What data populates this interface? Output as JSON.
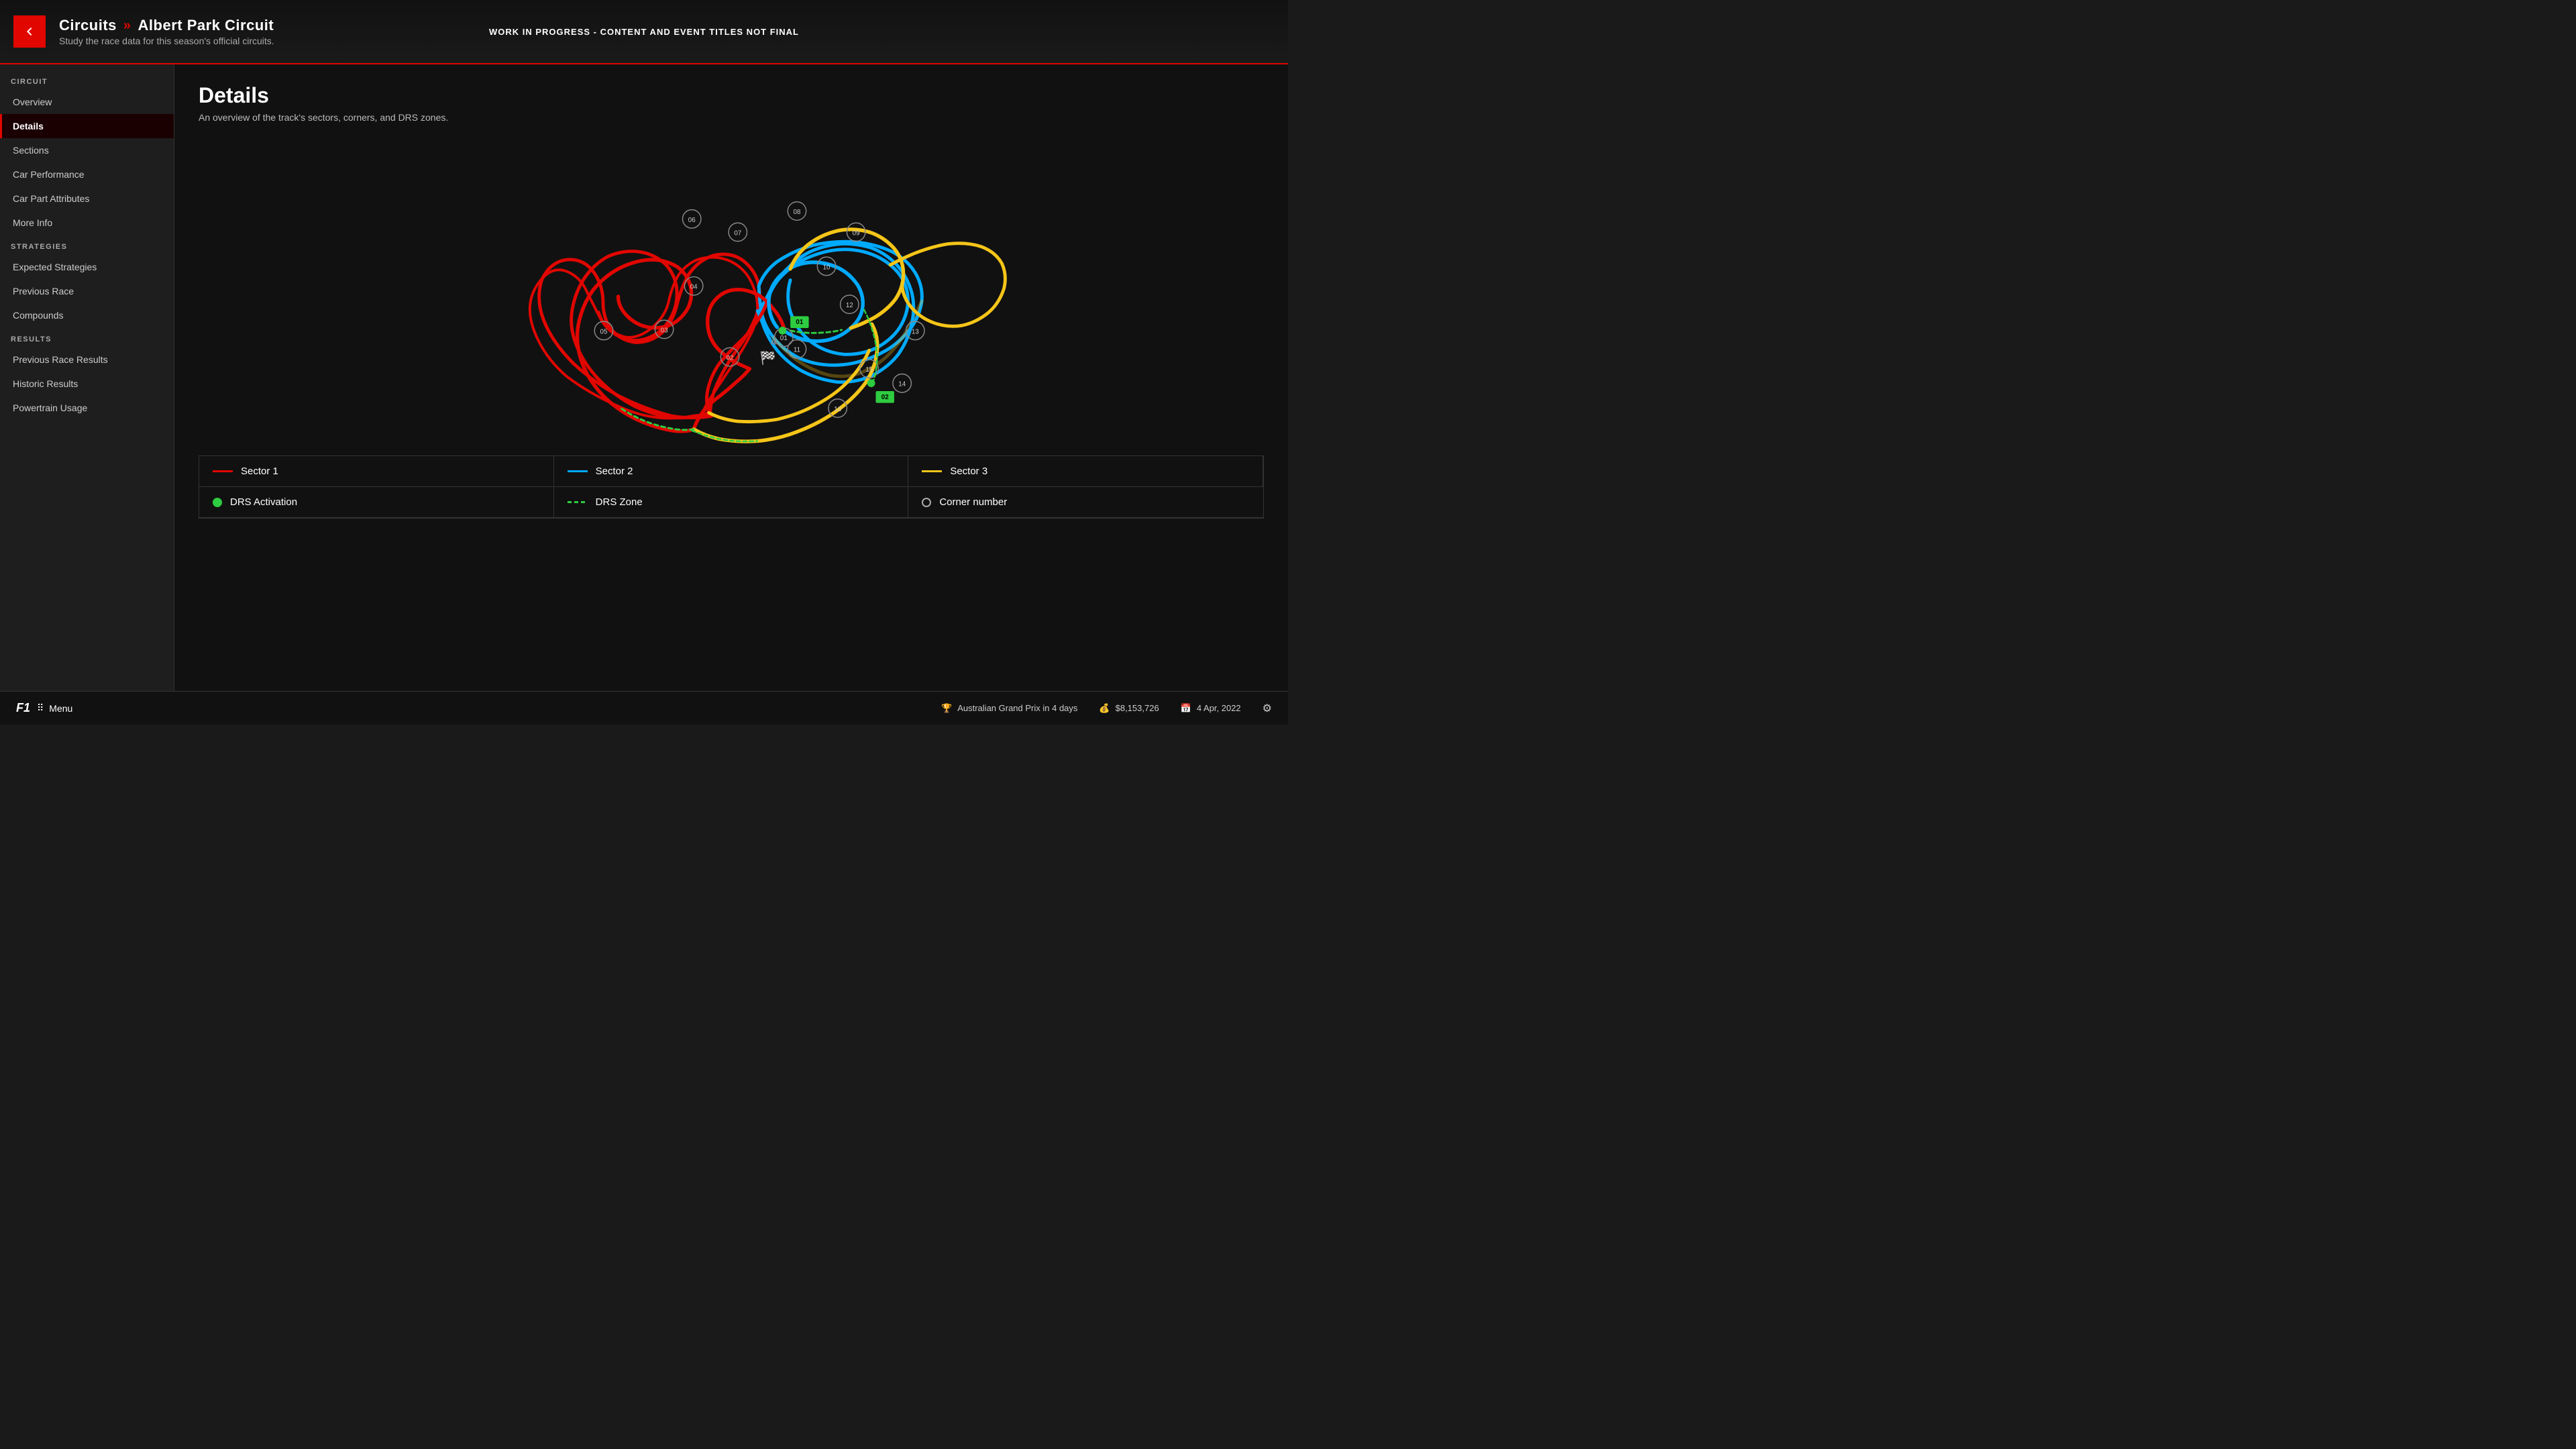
{
  "header": {
    "back_label": "←",
    "breadcrumb_root": "Circuits",
    "breadcrumb_current": "Albert Park Circuit",
    "subtitle": "Study the race data for this season's official circuits.",
    "wip_notice": "WORK IN PROGRESS - CONTENT AND EVENT TITLES NOT FINAL"
  },
  "sidebar": {
    "circuit_label": "CIRCUIT",
    "strategies_label": "STRATEGIES",
    "results_label": "RESULTS",
    "items_circuit": [
      {
        "id": "overview",
        "label": "Overview",
        "active": false
      },
      {
        "id": "details",
        "label": "Details",
        "active": true
      },
      {
        "id": "sections",
        "label": "Sections",
        "active": false
      },
      {
        "id": "car-performance",
        "label": "Car Performance",
        "active": false
      },
      {
        "id": "car-part-attributes",
        "label": "Car Part Attributes",
        "active": false
      },
      {
        "id": "more-info",
        "label": "More Info",
        "active": false
      }
    ],
    "items_strategies": [
      {
        "id": "expected-strategies",
        "label": "Expected Strategies",
        "active": false
      },
      {
        "id": "previous-race",
        "label": "Previous Race",
        "active": false
      },
      {
        "id": "compounds",
        "label": "Compounds",
        "active": false
      }
    ],
    "items_results": [
      {
        "id": "previous-race-results",
        "label": "Previous Race Results",
        "active": false
      },
      {
        "id": "historic-results",
        "label": "Historic Results",
        "active": false
      },
      {
        "id": "powertrain-usage",
        "label": "Powertrain Usage",
        "active": false
      }
    ]
  },
  "content": {
    "title": "Details",
    "subtitle": "An overview of the track's sectors, corners, and DRS zones.",
    "corners": [
      "01",
      "02",
      "03",
      "04",
      "05",
      "06",
      "07",
      "08",
      "09",
      "10",
      "11",
      "12",
      "13",
      "14",
      "15",
      "16"
    ],
    "drs_points": [
      "01",
      "02"
    ]
  },
  "legend": {
    "items": [
      {
        "id": "sector1",
        "type": "line",
        "color": "#e10600",
        "label": "Sector 1"
      },
      {
        "id": "sector2",
        "type": "line",
        "color": "#00aaff",
        "label": "Sector 2"
      },
      {
        "id": "sector3",
        "type": "line",
        "color": "#f5c518",
        "label": "Sector 3"
      },
      {
        "id": "drs-activation",
        "type": "dot",
        "color": "#2ecc40",
        "label": "DRS Activation"
      },
      {
        "id": "drs-zone",
        "type": "dashed",
        "color": "#2ecc40",
        "label": "DRS Zone"
      },
      {
        "id": "corner-number",
        "type": "circle",
        "color": "#aaa",
        "label": "Corner number"
      }
    ]
  },
  "statusbar": {
    "f1_logo": "F1",
    "menu_label": "Menu",
    "event": "Australian Grand Prix in 4 days",
    "money": "$8,153,726",
    "date": "4 Apr, 2022"
  }
}
